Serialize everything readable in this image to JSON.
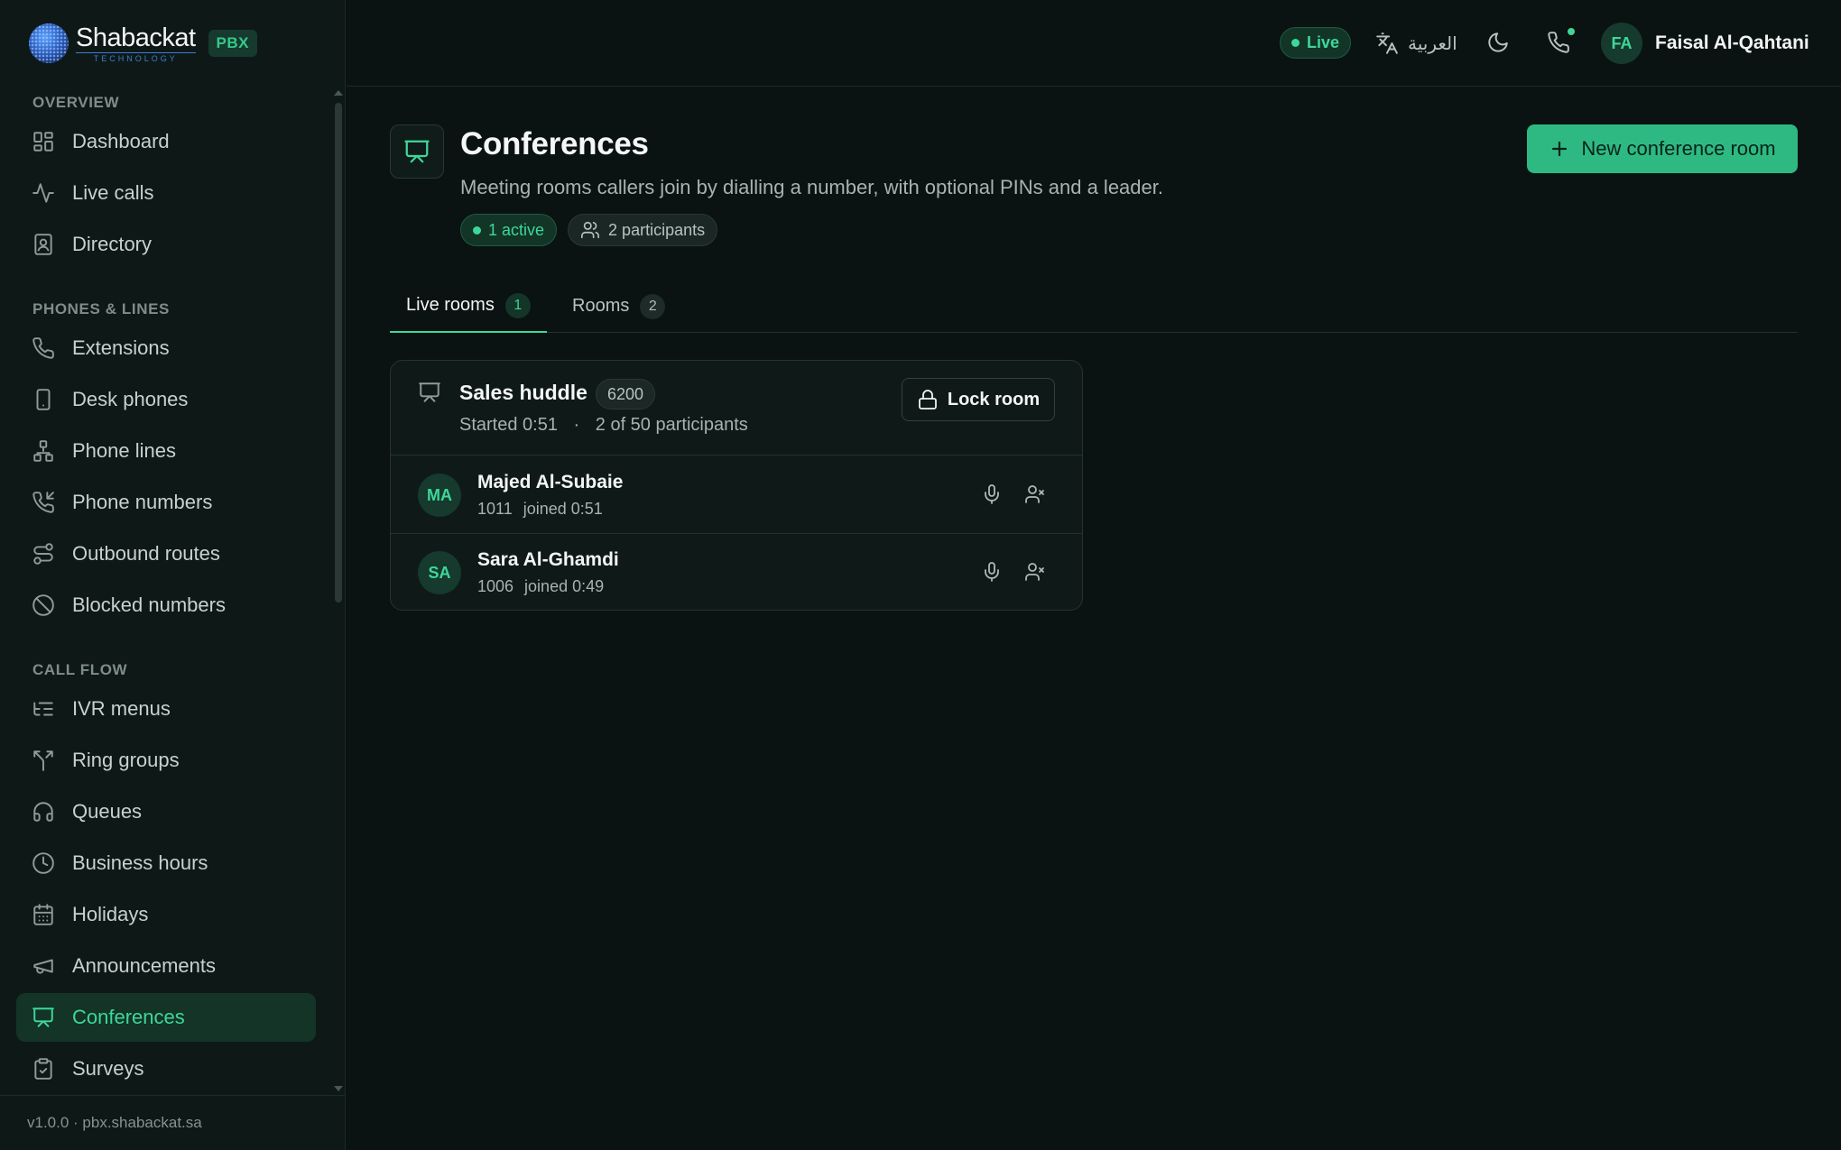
{
  "brand": {
    "name": "Shabackat",
    "tagline": "TECHNOLOGY",
    "product_badge": "PBX",
    "accent": "#3ed79a",
    "logo_blue": "#3d7bd4"
  },
  "sidebar": {
    "sections": [
      {
        "title": "OVERVIEW",
        "items": [
          {
            "label": "Dashboard",
            "icon": "grid-icon"
          },
          {
            "label": "Live calls",
            "icon": "pulse-icon"
          },
          {
            "label": "Directory",
            "icon": "contact-book-icon"
          }
        ]
      },
      {
        "title": "PHONES & LINES",
        "items": [
          {
            "label": "Extensions",
            "icon": "phone-icon"
          },
          {
            "label": "Desk phones",
            "icon": "smartphone-icon"
          },
          {
            "label": "Phone lines",
            "icon": "network-icon"
          },
          {
            "label": "Phone numbers",
            "icon": "phone-incoming-icon"
          },
          {
            "label": "Outbound routes",
            "icon": "route-icon"
          },
          {
            "label": "Blocked numbers",
            "icon": "block-icon"
          }
        ]
      },
      {
        "title": "CALL FLOW",
        "items": [
          {
            "label": "IVR menus",
            "icon": "list-tree-icon"
          },
          {
            "label": "Ring groups",
            "icon": "split-icon"
          },
          {
            "label": "Queues",
            "icon": "headphones-icon"
          },
          {
            "label": "Business hours",
            "icon": "clock-icon"
          },
          {
            "label": "Holidays",
            "icon": "calendar-icon"
          },
          {
            "label": "Announcements",
            "icon": "megaphone-icon"
          },
          {
            "label": "Conferences",
            "icon": "presentation-icon",
            "active": true
          },
          {
            "label": "Surveys",
            "icon": "clipboard-check-icon"
          }
        ]
      }
    ],
    "footer": "v1.0.0 · pbx.shabackat.sa"
  },
  "topbar": {
    "status": "Live",
    "language": "العربية",
    "user": {
      "initials": "FA",
      "name": "Faisal Al-Qahtani"
    }
  },
  "page": {
    "title": "Conferences",
    "subtitle": "Meeting rooms callers join by dialling a number, with optional PINs and a leader.",
    "chips": {
      "active": "1 active",
      "participants": "2 participants"
    },
    "new_button": "New conference room",
    "tabs": [
      {
        "label": "Live rooms",
        "count": "1",
        "active": true
      },
      {
        "label": "Rooms",
        "count": "2"
      }
    ]
  },
  "live_room": {
    "name": "Sales huddle",
    "number": "6200",
    "started": "Started 0:51",
    "separator": "·",
    "capacity": "2 of 50 participants",
    "lock_label": "Lock room",
    "participants": [
      {
        "initials": "MA",
        "name": "Majed Al-Subaie",
        "ext": "1011",
        "joined": "joined 0:51"
      },
      {
        "initials": "SA",
        "name": "Sara Al-Ghamdi",
        "ext": "1006",
        "joined": "joined 0:49"
      }
    ]
  }
}
